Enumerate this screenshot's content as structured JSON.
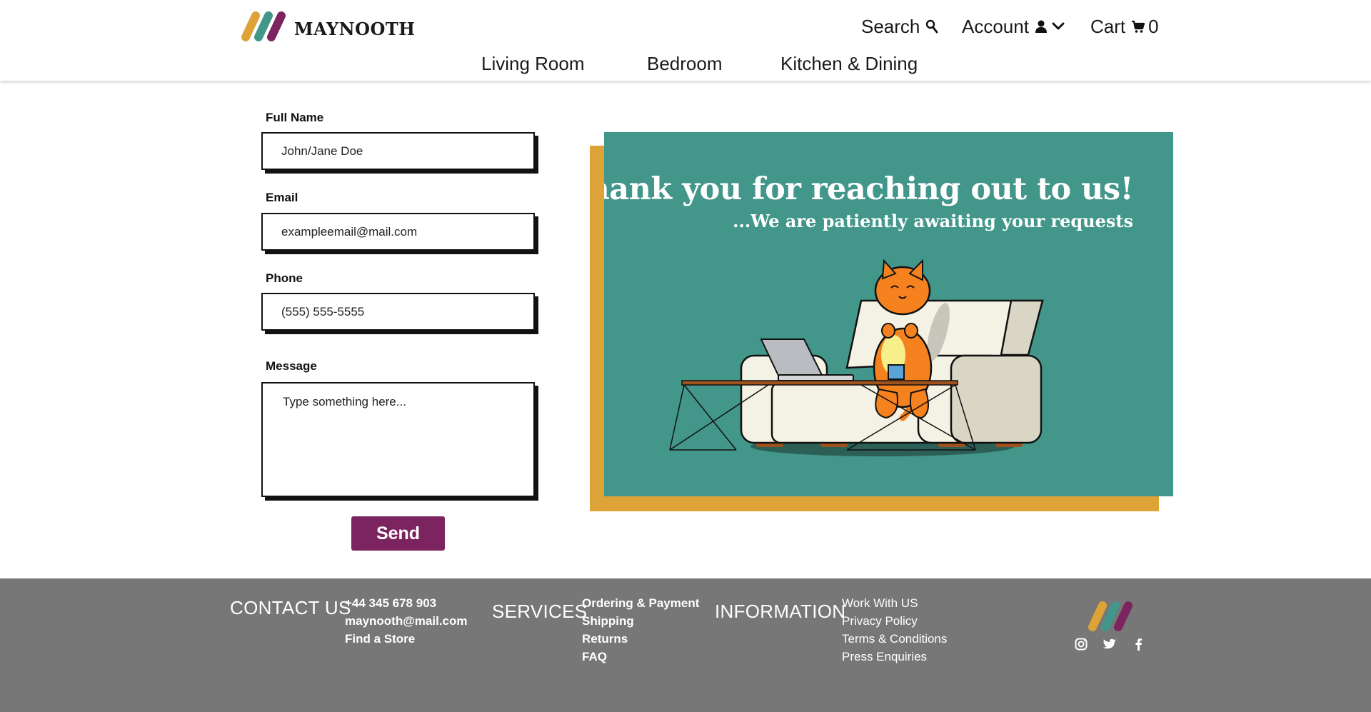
{
  "brand": {
    "name": "MAYNOOTH",
    "colors": {
      "yellow": "#dea337",
      "teal": "#42968a",
      "purple": "#7b2460"
    }
  },
  "header": {
    "search_label": "Search",
    "account_label": "Account",
    "cart_label": "Cart",
    "cart_count": "0",
    "categories": [
      "Living Room",
      "Bedroom",
      "Kitchen & Dining"
    ],
    "icons": [
      "search-icon",
      "user-icon",
      "chevron-down-icon",
      "cart-icon"
    ]
  },
  "form": {
    "full_name": {
      "label": "Full Name",
      "placeholder": "John/Jane Doe"
    },
    "email": {
      "label": "Email",
      "placeholder": "exampleemail@mail.com"
    },
    "phone": {
      "label": "Phone",
      "placeholder": "(555) 555-5555"
    },
    "message": {
      "label": "Message",
      "placeholder": "Type something here..."
    },
    "send_label": "Send"
  },
  "card": {
    "title": "Thank you for reaching out to us!",
    "subtitle": "...We are patiently awaiting your requests",
    "background": "#42968a",
    "shadow": "#dea337"
  },
  "footer": {
    "contact": {
      "heading": "CONTACT US",
      "items": [
        "+44 345 678 903",
        "maynooth@mail.com",
        "Find a Store"
      ]
    },
    "services": {
      "heading": "SERVICES",
      "items": [
        "Ordering & Payment",
        "Shipping",
        "Returns",
        "FAQ"
      ]
    },
    "information": {
      "heading": "INFORMATION",
      "items": [
        "Work With US",
        "Privacy Policy",
        "Terms & Conditions",
        "Press Enquiries"
      ]
    },
    "social_icons": [
      "instagram-icon",
      "twitter-icon",
      "facebook-icon"
    ],
    "background": "#777777"
  }
}
